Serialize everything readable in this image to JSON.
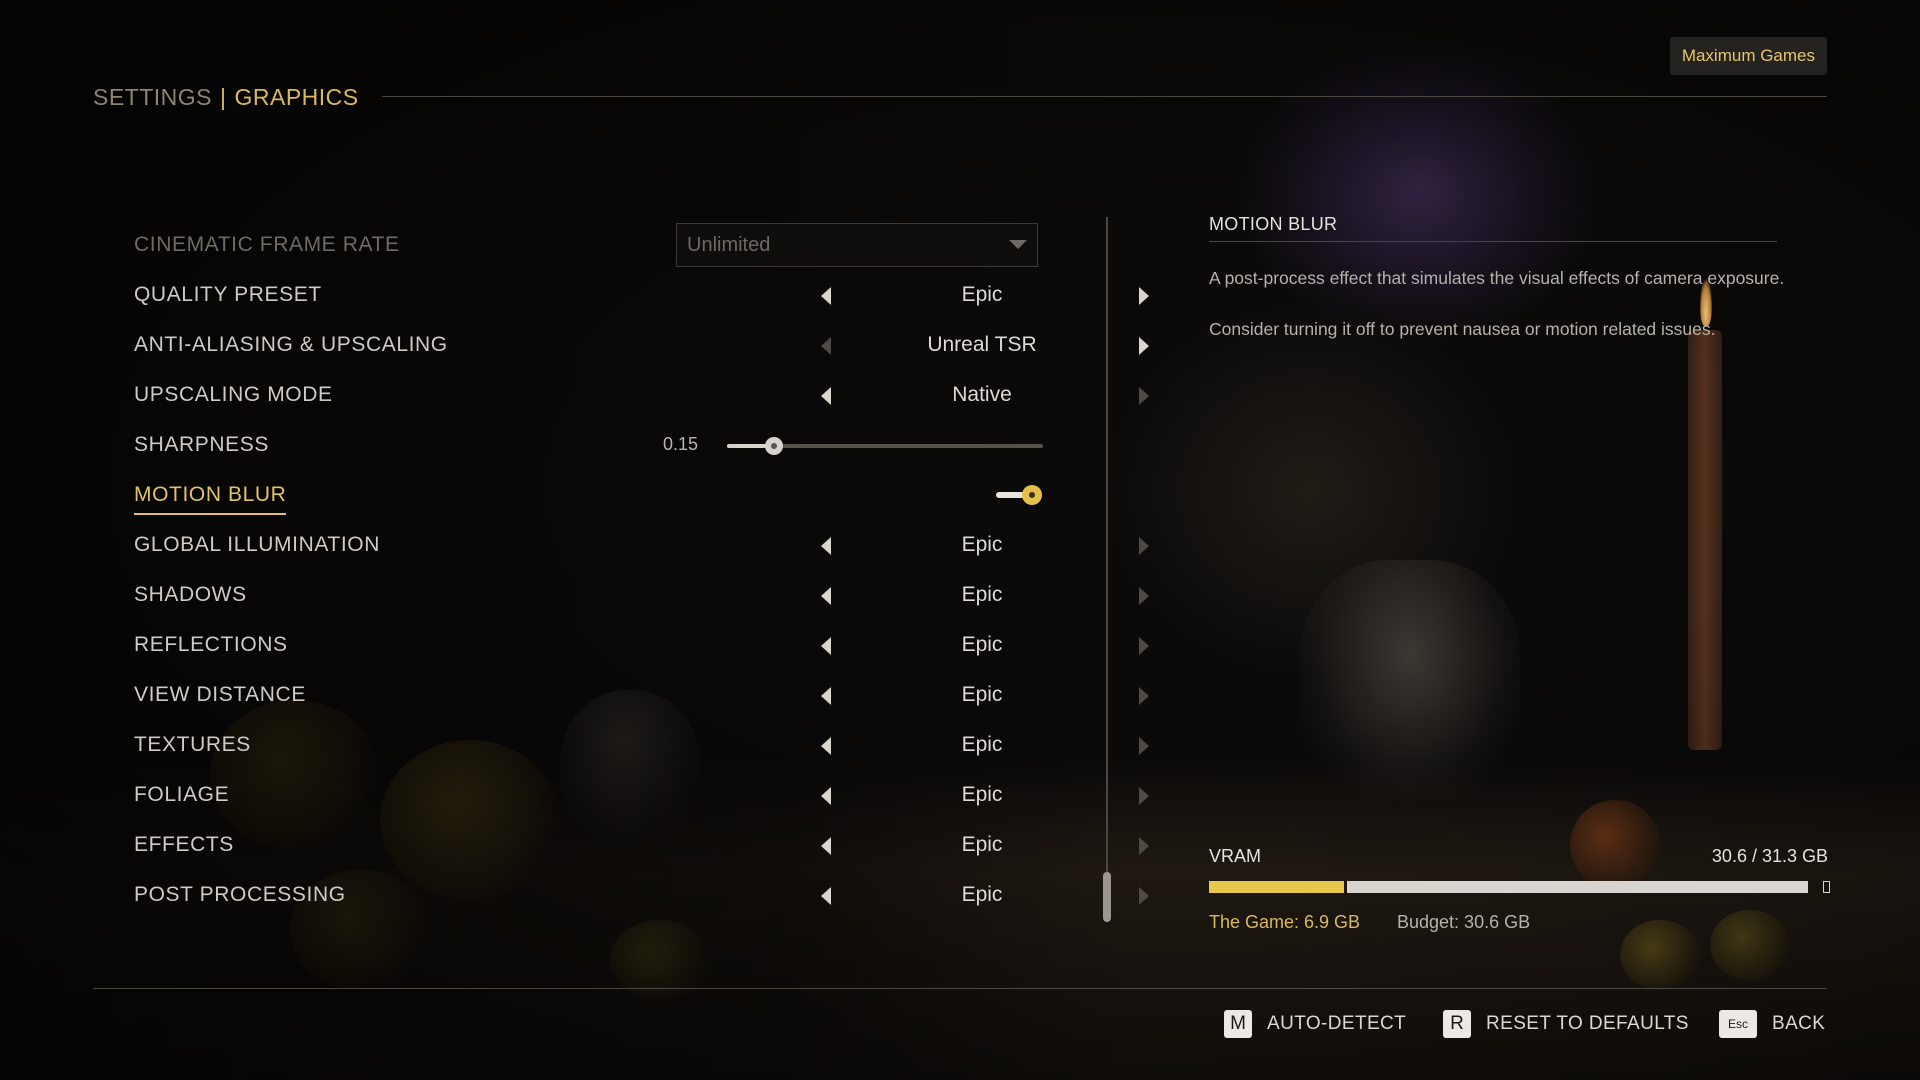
{
  "header": {
    "breadcrumb_parent": "SETTINGS",
    "breadcrumb_separator": "|",
    "breadcrumb_current": "GRAPHICS",
    "badge": "Maximum Games"
  },
  "settings": {
    "cinematic_frame_rate": {
      "label": "CINEMATIC FRAME RATE",
      "value": "Unlimited"
    },
    "quality_preset": {
      "label": "QUALITY PRESET",
      "value": "Epic"
    },
    "anti_aliasing": {
      "label": "ANTI-ALIASING & UPSCALING",
      "value": "Unreal TSR"
    },
    "upscaling_mode": {
      "label": "UPSCALING MODE",
      "value": "Native"
    },
    "sharpness": {
      "label": "SHARPNESS",
      "value": "0.15",
      "level_fraction": 0.15
    },
    "motion_blur": {
      "label": "MOTION BLUR",
      "enabled": true
    },
    "global_illumination": {
      "label": "GLOBAL ILLUMINATION",
      "value": "Epic"
    },
    "shadows": {
      "label": "SHADOWS",
      "value": "Epic"
    },
    "reflections": {
      "label": "REFLECTIONS",
      "value": "Epic"
    },
    "view_distance": {
      "label": "VIEW DISTANCE",
      "value": "Epic"
    },
    "textures": {
      "label": "TEXTURES",
      "value": "Epic"
    },
    "foliage": {
      "label": "FOLIAGE",
      "value": "Epic"
    },
    "effects": {
      "label": "EFFECTS",
      "value": "Epic"
    },
    "post_processing": {
      "label": "POST PROCESSING",
      "value": "Epic"
    }
  },
  "info": {
    "title": "MOTION BLUR",
    "paragraph1": "A post-process effect that simulates the visual effects of camera exposure.",
    "paragraph2": "Consider turning it off to prevent nausea or motion related issues."
  },
  "vram": {
    "label": "VRAM",
    "value": "30.6 / 31.3 GB",
    "game_gb": 6.9,
    "budget_gb": 30.6,
    "total_gb": 31.3,
    "game_label": "The Game: 6.9 GB",
    "budget_label": "Budget: 30.6 GB"
  },
  "footer": {
    "auto_detect": {
      "key": "M",
      "label": "AUTO-DETECT"
    },
    "reset": {
      "key": "R",
      "label": "RESET TO DEFAULTS"
    },
    "back": {
      "key": "Esc",
      "label": "BACK"
    }
  },
  "colors": {
    "accent": "#d8b95d",
    "toggle_on": "#e2c049",
    "vram_game": "#e7c84c",
    "vram_budget": "#d8d4cf"
  }
}
